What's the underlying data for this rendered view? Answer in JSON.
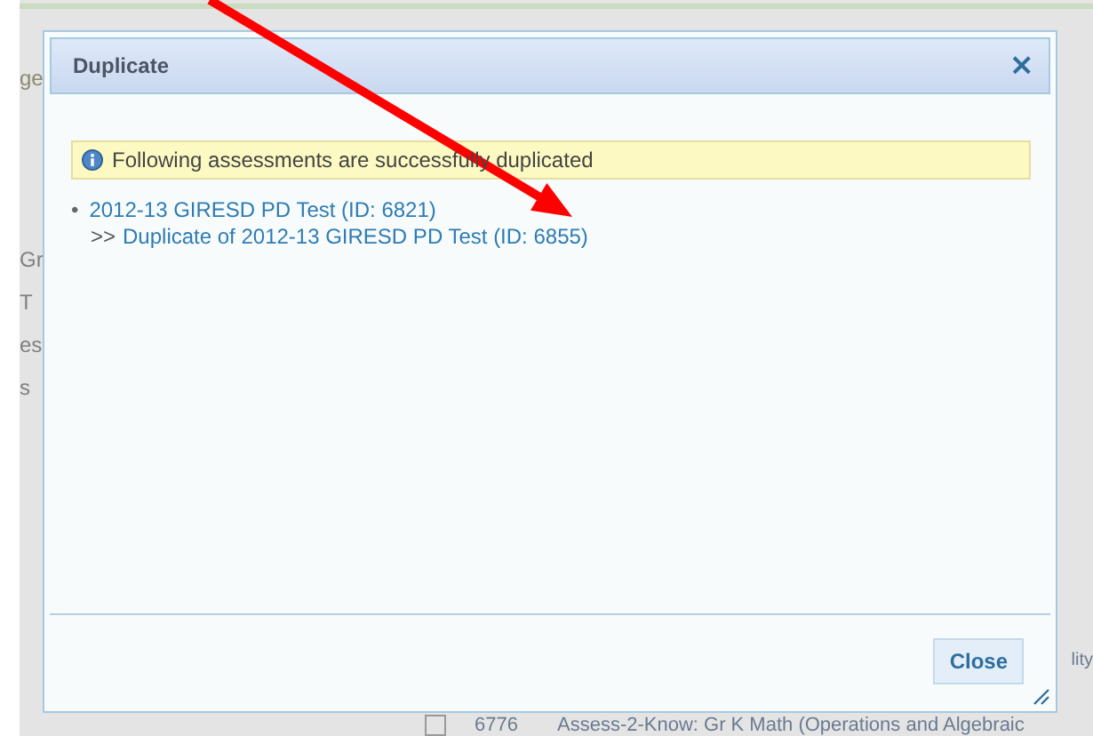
{
  "background": {
    "fragments": [
      "ge",
      "Gr",
      "T",
      "es",
      "s"
    ],
    "side_text": "lity",
    "row": {
      "checked": false,
      "id": "6776",
      "title": "Assess-2-Know: Gr K Math (Operations and Algebraic"
    }
  },
  "dialog": {
    "title": "Duplicate",
    "close_glyph": "×",
    "message": "Following assessments are successfully duplicated",
    "items": [
      {
        "bullet": "•",
        "source": "2012-13 GIRESD PD Test (ID: 6821)",
        "prefix": ">>",
        "copy": "Duplicate of 2012-13 GIRESD PD Test (ID: 6855)"
      }
    ],
    "buttons": [
      "Close"
    ]
  }
}
